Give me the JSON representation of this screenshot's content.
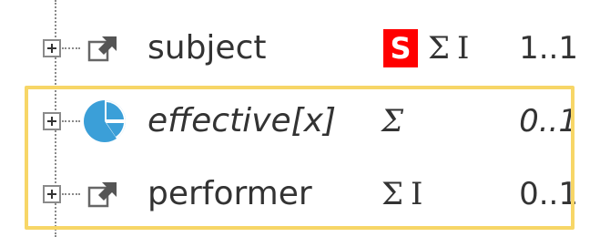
{
  "rows": [
    {
      "name": "subject",
      "italic": false,
      "icon": "reference-icon",
      "flags": {
        "s_badge": "S",
        "summary": "Σ",
        "modifier": "I"
      },
      "cardinality": "1..1"
    },
    {
      "name": "effective[x]",
      "italic": true,
      "icon": "choice-type-icon",
      "flags": {
        "summary": "Σ"
      },
      "cardinality": "0..1"
    },
    {
      "name": "performer",
      "italic": false,
      "icon": "reference-icon",
      "flags": {
        "summary": "Σ",
        "modifier": "I"
      },
      "cardinality": "0..1"
    }
  ],
  "colors": {
    "s_badge_bg": "#ff0000",
    "highlight_border": "#f7d667",
    "choice_icon": "#3b9fd8",
    "tree_lines": "#8a8a8a"
  }
}
